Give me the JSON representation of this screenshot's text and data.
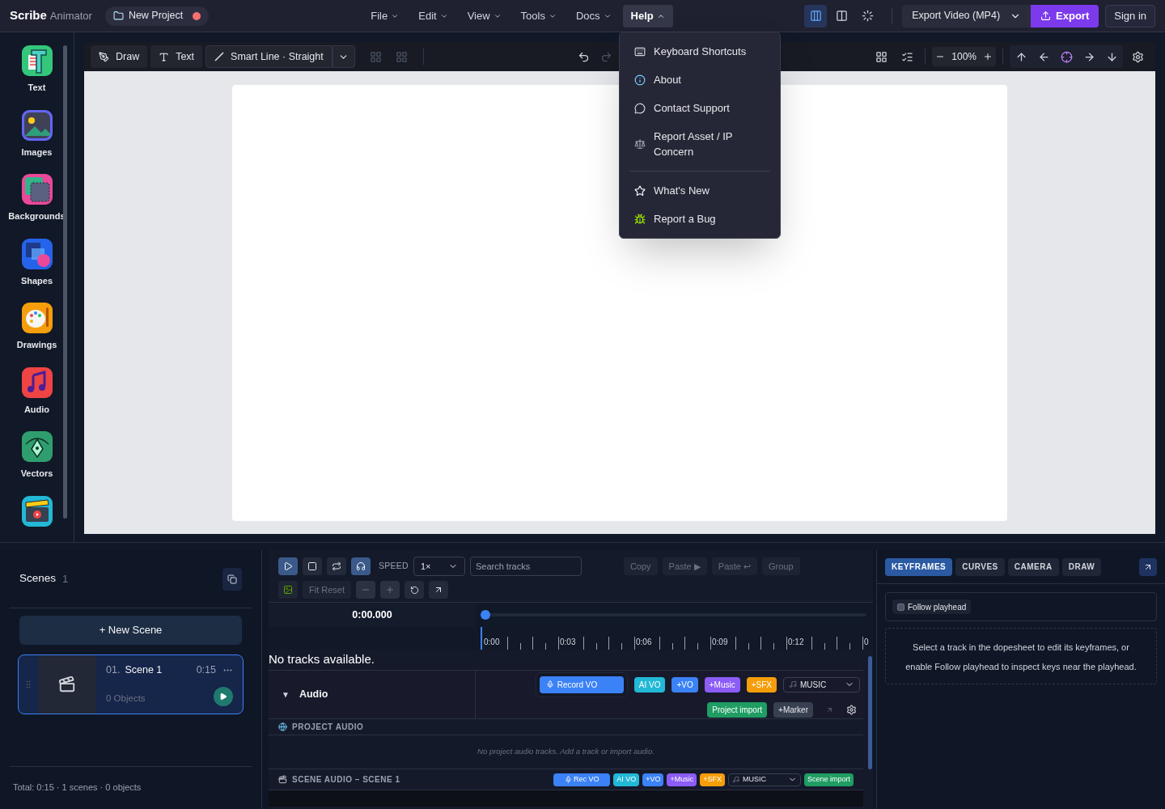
{
  "brand": {
    "name": "Scribe",
    "suffix": "Animator"
  },
  "project": {
    "name": "New Project",
    "unsaved": true
  },
  "menus": [
    {
      "label": "File",
      "selected": false
    },
    {
      "label": "Edit",
      "selected": false
    },
    {
      "label": "View",
      "selected": false
    },
    {
      "label": "Tools",
      "selected": false
    },
    {
      "label": "Docs",
      "selected": false
    },
    {
      "label": "Help",
      "selected": true
    }
  ],
  "layouts": [
    {
      "kind": "split",
      "selected": true
    },
    {
      "kind": "columns",
      "selected": false
    },
    {
      "kind": "loader",
      "selected": false
    }
  ],
  "export": {
    "format": "Export Video (MP4)",
    "button": "Export"
  },
  "sign_in": "Sign in",
  "help_menu": [
    [
      {
        "kind": "keyboard",
        "label": "Keyboard Shortcuts"
      },
      {
        "kind": "info",
        "label": "About"
      },
      {
        "kind": "chat",
        "label": "Contact Support"
      },
      {
        "kind": "scales",
        "label": "Report Asset / IP Concern"
      }
    ],
    [
      {
        "kind": "star",
        "label": "What's New"
      },
      {
        "kind": "bug",
        "label": "Report a Bug"
      }
    ]
  ],
  "sidebar": [
    {
      "kind": "text",
      "label": "Text"
    },
    {
      "kind": "images",
      "label": "Images"
    },
    {
      "kind": "backgrounds",
      "label": "Backgrounds"
    },
    {
      "kind": "shapes",
      "label": "Shapes"
    },
    {
      "kind": "drawings",
      "label": "Drawings"
    },
    {
      "kind": "audio",
      "label": "Audio"
    },
    {
      "kind": "vectors",
      "label": "Vectors"
    },
    {
      "kind": "video"
    }
  ],
  "toolbar": {
    "tools": [
      {
        "kind": "draw",
        "label": "Draw"
      },
      {
        "kind": "text",
        "label": "Text"
      },
      {
        "kind": "line",
        "label": "Smart Line · Straight"
      }
    ],
    "zoom": "100%"
  },
  "scenes": {
    "title": "Scenes",
    "count": "1",
    "new_button": "+ New Scene",
    "items": [
      {
        "number": "01.",
        "name": "Scene 1",
        "duration": "0:15",
        "objects": "0 Objects",
        "selected": true
      }
    ],
    "footer": "Total: 0:15 · 1 scenes · 0 objects"
  },
  "timeline": {
    "speed_label": "SPEED",
    "speed": "1×",
    "search_placeholder": "Search tracks",
    "transport": [
      {
        "kind": "play",
        "on": true
      },
      {
        "kind": "stop",
        "on": false
      },
      {
        "kind": "loop",
        "on": false
      },
      {
        "kind": "headphones",
        "on": true
      }
    ],
    "edit_buttons": [
      {
        "label": "Copy",
        "disabled": true
      },
      {
        "label": "Paste ▶",
        "disabled": true
      },
      {
        "label": "Paste ↩",
        "disabled": true
      },
      {
        "label": "Group",
        "disabled": true
      }
    ],
    "fit_label": "Fit Reset",
    "time": "0:00.000",
    "playhead": {
      "level": 0
    },
    "ruler": [
      "0:00",
      "0:03",
      "0:06",
      "0:09",
      "0:12",
      "0"
    ],
    "empty": "No tracks available.",
    "audio": {
      "caret": "▼",
      "title": "Audio",
      "expanded": true,
      "record": "Record VO",
      "chips": [
        {
          "label": "AI VO",
          "color": "#22b8d6"
        },
        {
          "label": "+VO",
          "color": "#3b82f6"
        },
        {
          "label": "+Music",
          "color": "#8b5cf6"
        },
        {
          "label": "+SFX",
          "color": "#f59e0b"
        }
      ],
      "music": "MUSIC",
      "import": "Project import",
      "marker": "+Marker"
    },
    "project_audio": {
      "title": "PROJECT AUDIO",
      "empty": "No project audio tracks. Add a track or import audio."
    },
    "scene_audio": {
      "title": "SCENE AUDIO – SCENE 1",
      "record": "Rec VO",
      "chips": [
        {
          "label": "AI VO",
          "color": "#22b8d6"
        },
        {
          "label": "+VO",
          "color": "#3b82f6"
        },
        {
          "label": "+Music",
          "color": "#8b5cf6"
        },
        {
          "label": "+SFX",
          "color": "#f59e0b"
        }
      ],
      "music": "MUSIC",
      "import": "Scene import"
    }
  },
  "inspector": {
    "tabs": [
      {
        "label": "KEYFRAMES",
        "selected": true
      },
      {
        "label": "CURVES",
        "selected": false
      },
      {
        "label": "CAMERA",
        "selected": false
      },
      {
        "label": "DRAW",
        "selected": false
      }
    ],
    "follow": {
      "label": "Follow playhead",
      "checked": false
    },
    "hint": "Select a track in the dopesheet to edit its keyframes, or enable Follow playhead to inspect keys near the playhead."
  }
}
